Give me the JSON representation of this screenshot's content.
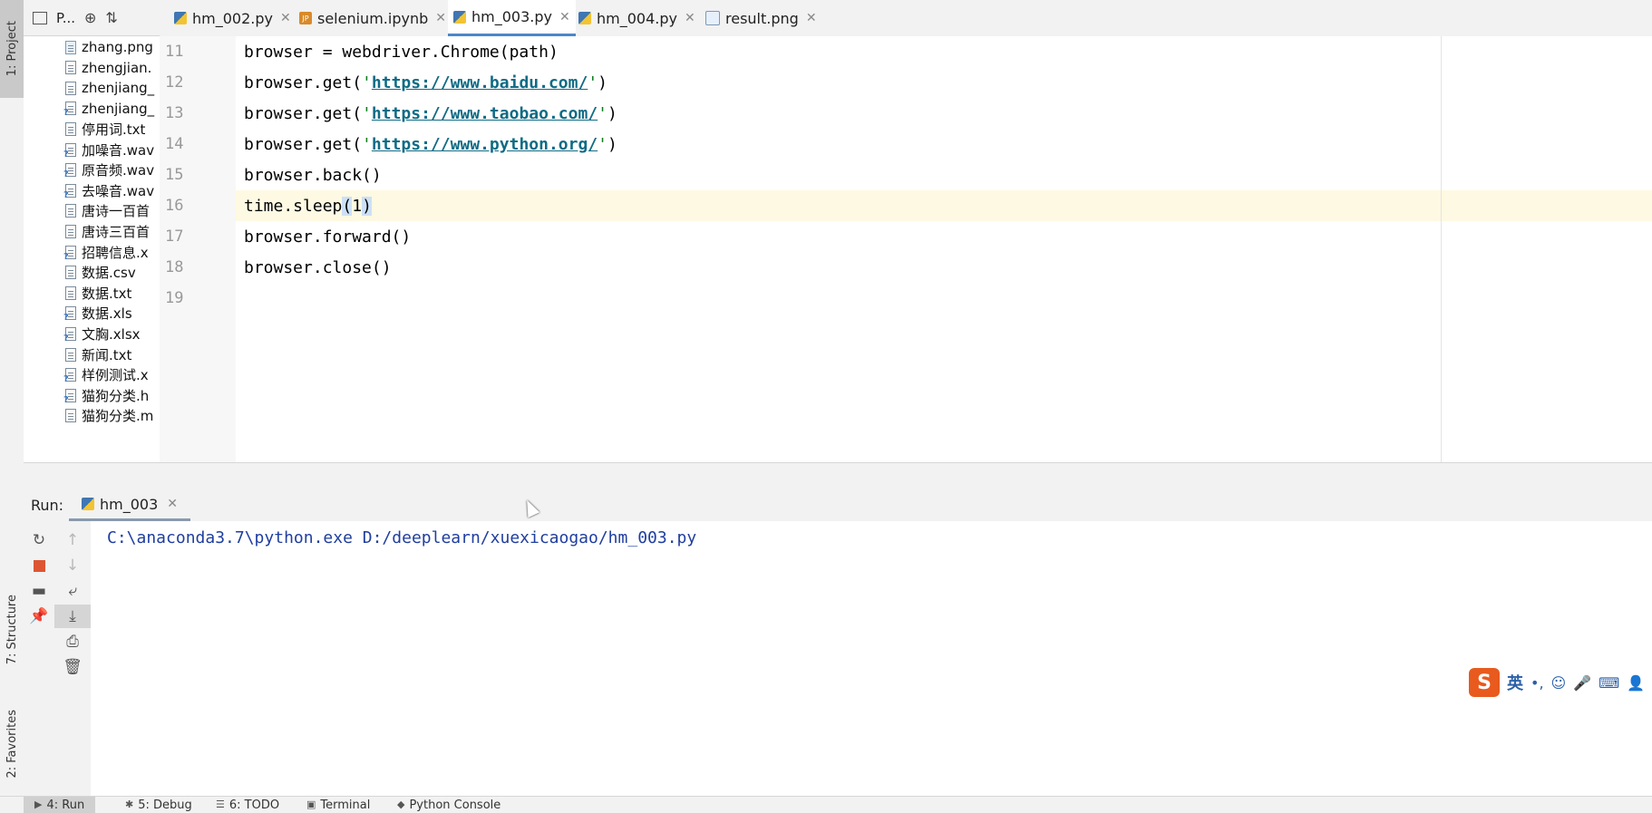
{
  "sidebar": {
    "project_tab": "1: Project",
    "structure_tab": "7: Structure",
    "favorites_tab": "2: Favorites"
  },
  "project_toolbar": {
    "label": "P..."
  },
  "project_tree": {
    "items": [
      {
        "name": "zhang.png",
        "icon": "image-file-icon"
      },
      {
        "name": "zhengjian.",
        "icon": "text-file-icon"
      },
      {
        "name": "zhenjiang_",
        "icon": "text-file-icon"
      },
      {
        "name": "zhenjiang_",
        "icon": "unknown-file-icon"
      },
      {
        "name": "停用词.txt",
        "icon": "text-file-icon"
      },
      {
        "name": "加噪音.wav",
        "icon": "unknown-file-icon"
      },
      {
        "name": "原音频.wav",
        "icon": "unknown-file-icon"
      },
      {
        "name": "去噪音.wav",
        "icon": "unknown-file-icon"
      },
      {
        "name": "唐诗一百首",
        "icon": "text-file-icon"
      },
      {
        "name": "唐诗三百首",
        "icon": "text-file-icon"
      },
      {
        "name": "招聘信息.x",
        "icon": "unknown-file-icon"
      },
      {
        "name": "数据.csv",
        "icon": "text-file-icon"
      },
      {
        "name": "数据.txt",
        "icon": "text-file-icon"
      },
      {
        "name": "数据.xls",
        "icon": "unknown-file-icon"
      },
      {
        "name": "文胸.xlsx",
        "icon": "unknown-file-icon"
      },
      {
        "name": "新闻.txt",
        "icon": "text-file-icon"
      },
      {
        "name": "样例测试.x",
        "icon": "unknown-file-icon"
      },
      {
        "name": "猫狗分类.h",
        "icon": "unknown-file-icon"
      },
      {
        "name": "猫狗分类.m",
        "icon": "text-file-icon"
      }
    ]
  },
  "tabs": [
    {
      "label": "hm_002.py",
      "type": "py",
      "active": false
    },
    {
      "label": "selenium.ipynb",
      "type": "ipynb",
      "active": false
    },
    {
      "label": "hm_003.py",
      "type": "py",
      "active": true
    },
    {
      "label": "hm_004.py",
      "type": "py",
      "active": false
    },
    {
      "label": "result.png",
      "type": "png",
      "active": false
    }
  ],
  "editor": {
    "lines": [
      {
        "no": "11",
        "p1": "browser = webdriver.Chrome(path)"
      },
      {
        "no": "12",
        "pre": "browser.get(",
        "q1": "'",
        "url": "https://www.baidu.com/",
        "q2": "'",
        "post": ")"
      },
      {
        "no": "13",
        "pre": "browser.get(",
        "q1": "'",
        "url": "https://www.taobao.com/",
        "q2": "'",
        "post": ")"
      },
      {
        "no": "14",
        "pre": "browser.get(",
        "q1": "'",
        "url": "https://www.python.org/",
        "q2": "'",
        "post": ")"
      },
      {
        "no": "15",
        "p1": "browser.back()"
      },
      {
        "no": "16",
        "pre": "time.sleep",
        "hl1": "(",
        "mid": "1",
        "hl2": ")",
        "current": true
      },
      {
        "no": "17",
        "p1": "browser.forward()"
      },
      {
        "no": "18",
        "p1": "browser.close()"
      },
      {
        "no": "19",
        "p1": ""
      }
    ]
  },
  "run_panel": {
    "label": "Run:",
    "tab_label": "hm_003",
    "console_output": "C:\\anaconda3.7\\python.exe D:/deeplearn/xuexicaogao/hm_003.py"
  },
  "ime": {
    "lang": "英"
  },
  "bottom_bar": [
    {
      "label": "4: Run",
      "icon": "▶",
      "active": true
    },
    {
      "label": "5: Debug",
      "icon": "✱",
      "active": false
    },
    {
      "label": "6: TODO",
      "icon": "☰",
      "active": false
    },
    {
      "label": "Terminal",
      "icon": "▣",
      "active": false
    },
    {
      "label": "Python Console",
      "icon": "◆",
      "active": false
    }
  ],
  "colors": {
    "accent": "#4a88c7",
    "string": "#067d17",
    "url": "#0f6b85",
    "console_text": "#1f3e9f",
    "current_line": "#fef9e2"
  }
}
